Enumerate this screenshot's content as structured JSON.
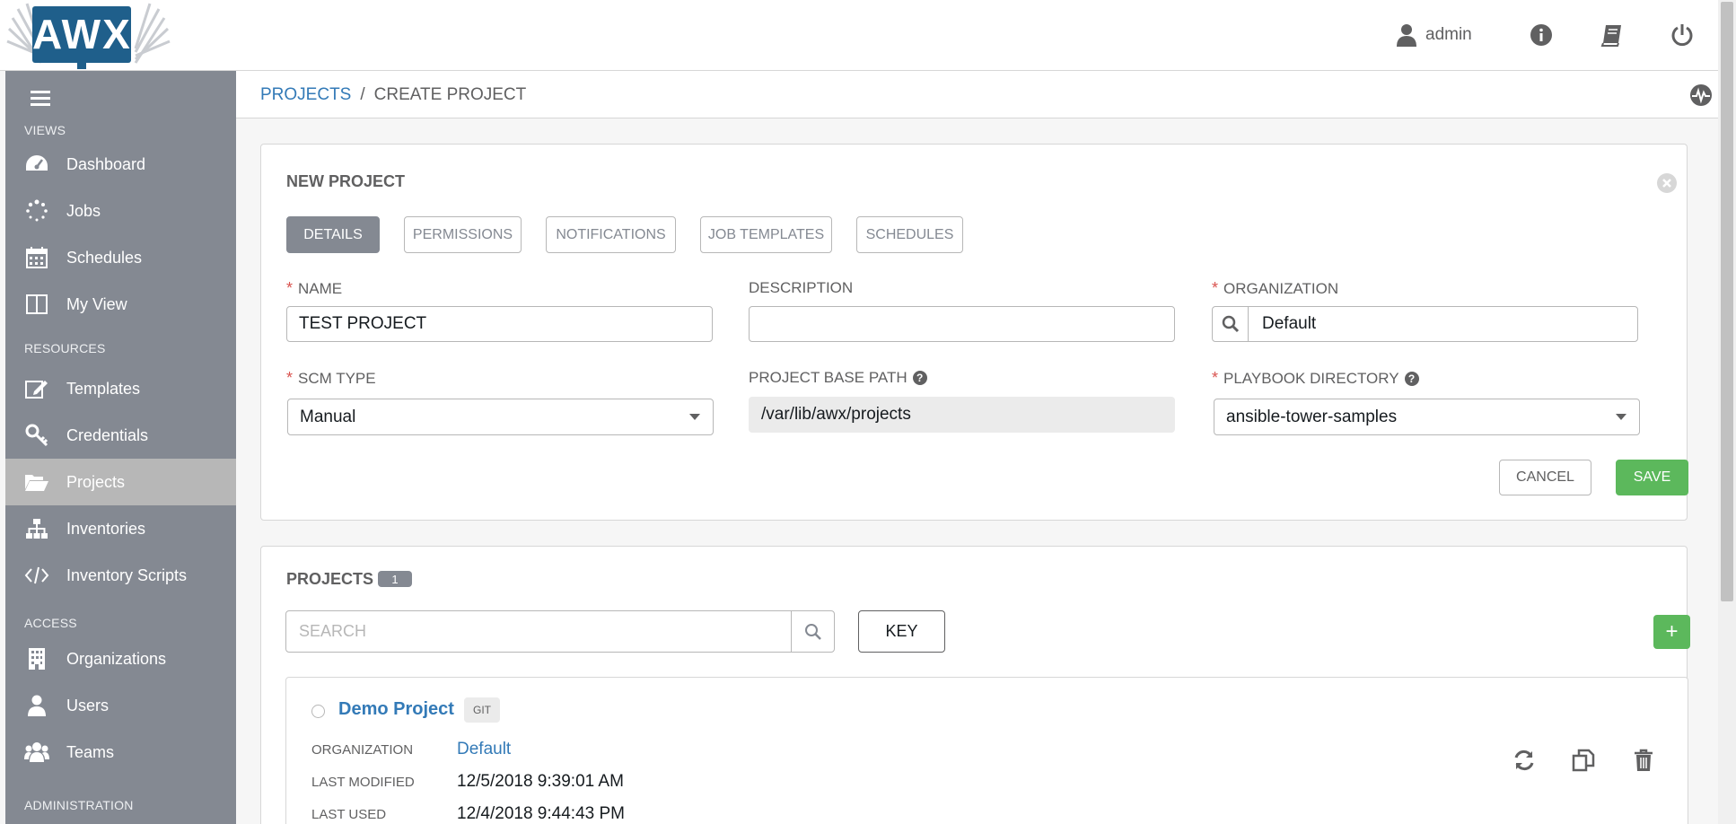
{
  "app": {
    "logo_text": "AWX"
  },
  "header": {
    "username": "admin"
  },
  "sidebar": {
    "sections": {
      "views": "VIEWS",
      "resources": "RESOURCES",
      "access": "ACCESS",
      "administration": "ADMINISTRATION"
    },
    "items": [
      {
        "label": "Dashboard",
        "icon": "dashboard-icon"
      },
      {
        "label": "Jobs",
        "icon": "spinner-icon"
      },
      {
        "label": "Schedules",
        "icon": "calendar-icon"
      },
      {
        "label": "My View",
        "icon": "columns-icon"
      },
      {
        "label": "Templates",
        "icon": "edit-icon"
      },
      {
        "label": "Credentials",
        "icon": "key-icon"
      },
      {
        "label": "Projects",
        "icon": "folder-open-icon",
        "active": true
      },
      {
        "label": "Inventories",
        "icon": "sitemap-icon"
      },
      {
        "label": "Inventory Scripts",
        "icon": "code-icon"
      },
      {
        "label": "Organizations",
        "icon": "building-icon"
      },
      {
        "label": "Users",
        "icon": "user-icon"
      },
      {
        "label": "Teams",
        "icon": "users-icon"
      }
    ]
  },
  "breadcrumb": {
    "parent": "PROJECTS",
    "separator": "/",
    "current": "CREATE PROJECT"
  },
  "form": {
    "title": "NEW PROJECT",
    "tabs": [
      "DETAILS",
      "PERMISSIONS",
      "NOTIFICATIONS",
      "JOB TEMPLATES",
      "SCHEDULES"
    ],
    "fields": {
      "name": {
        "label": "NAME",
        "value": "TEST PROJECT"
      },
      "description": {
        "label": "DESCRIPTION",
        "value": ""
      },
      "organization": {
        "label": "ORGANIZATION",
        "value": "Default"
      },
      "scm_type": {
        "label": "SCM TYPE",
        "value": "Manual"
      },
      "base_path": {
        "label": "PROJECT BASE PATH",
        "value": "/var/lib/awx/projects"
      },
      "playbook_dir": {
        "label": "PLAYBOOK DIRECTORY",
        "value": "ansible-tower-samples"
      }
    },
    "cancel_label": "CANCEL",
    "save_label": "SAVE"
  },
  "projects_list": {
    "title": "PROJECTS",
    "count": "1",
    "search_placeholder": "SEARCH",
    "key_label": "KEY",
    "add_label": "+",
    "items": [
      {
        "name": "Demo Project",
        "scm": "GIT",
        "organization_label": "ORGANIZATION",
        "organization": "Default",
        "last_modified_label": "LAST MODIFIED",
        "last_modified": "12/5/2018 9:39:01 AM",
        "last_used_label": "LAST USED",
        "last_used": "12/4/2018 9:44:43 PM"
      }
    ]
  },
  "colors": {
    "sidebar_bg": "#848992",
    "sidebar_active": "#b7b7b7",
    "link": "#337ab7",
    "success": "#5cb85c",
    "required": "#d9534f"
  }
}
